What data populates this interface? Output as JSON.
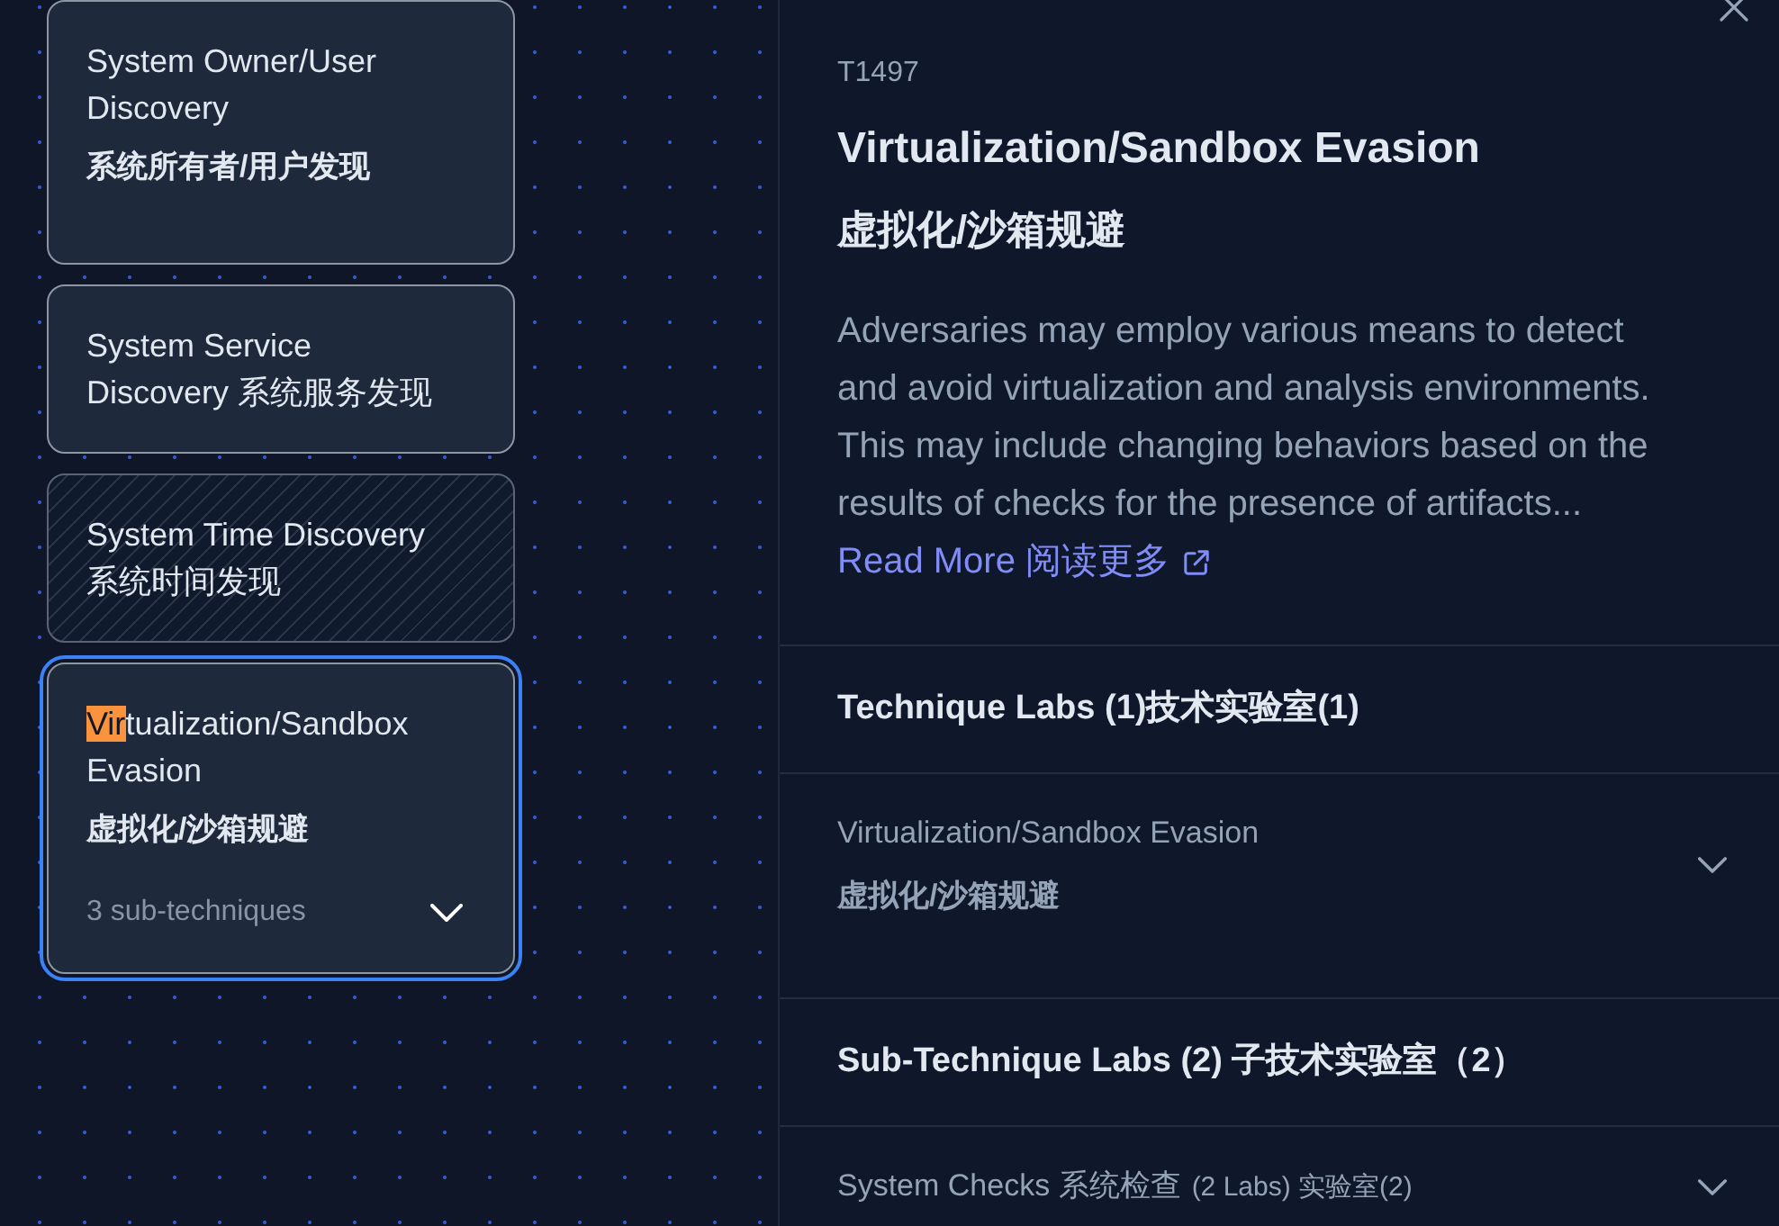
{
  "technique_cards": [
    {
      "title": "System Owner/User Discovery",
      "subtitle": "系统所有者/用户发现",
      "hatched": false,
      "selected": false
    },
    {
      "title": "System Service Discovery 系统服务发现",
      "hatched": false,
      "selected": false
    },
    {
      "title": "System Time Discovery 系统时间发现",
      "hatched": true,
      "selected": false
    },
    {
      "title_parts": [
        {
          "text": "Vir",
          "highlighted": true
        },
        {
          "text": "tualization/Sandbox Evasion",
          "highlighted": false
        }
      ],
      "subtitle": "虚拟化/沙箱规避",
      "sub_count": "3 sub-techniques",
      "expanded": false,
      "hatched": false,
      "selected": true
    }
  ],
  "detail_panel": {
    "technique_id": "T1497",
    "title": "Virtualization/Sandbox Evasion",
    "title_zh": "虚拟化/沙箱规避",
    "description": "Adversaries may employ various means to detect and avoid virtualization and analysis environments. This may include changing behaviors based on the results of checks for the presence of artifacts...",
    "read_more_link": "Read More 阅读更多",
    "sections": [
      {
        "heading": "Technique Labs (1)技术实验室(1)",
        "labs": [
          {
            "title": "Virtualization/Sandbox Evasion",
            "subtitle": "虚拟化/沙箱规避",
            "expanded": false
          }
        ]
      },
      {
        "heading": "Sub-Technique Labs (2) 子技术实验室（2）",
        "labs": [
          {
            "title": "System Checks 系统检查",
            "count": "(2 Labs) 实验室(2)",
            "expanded": false
          }
        ]
      }
    ]
  }
}
